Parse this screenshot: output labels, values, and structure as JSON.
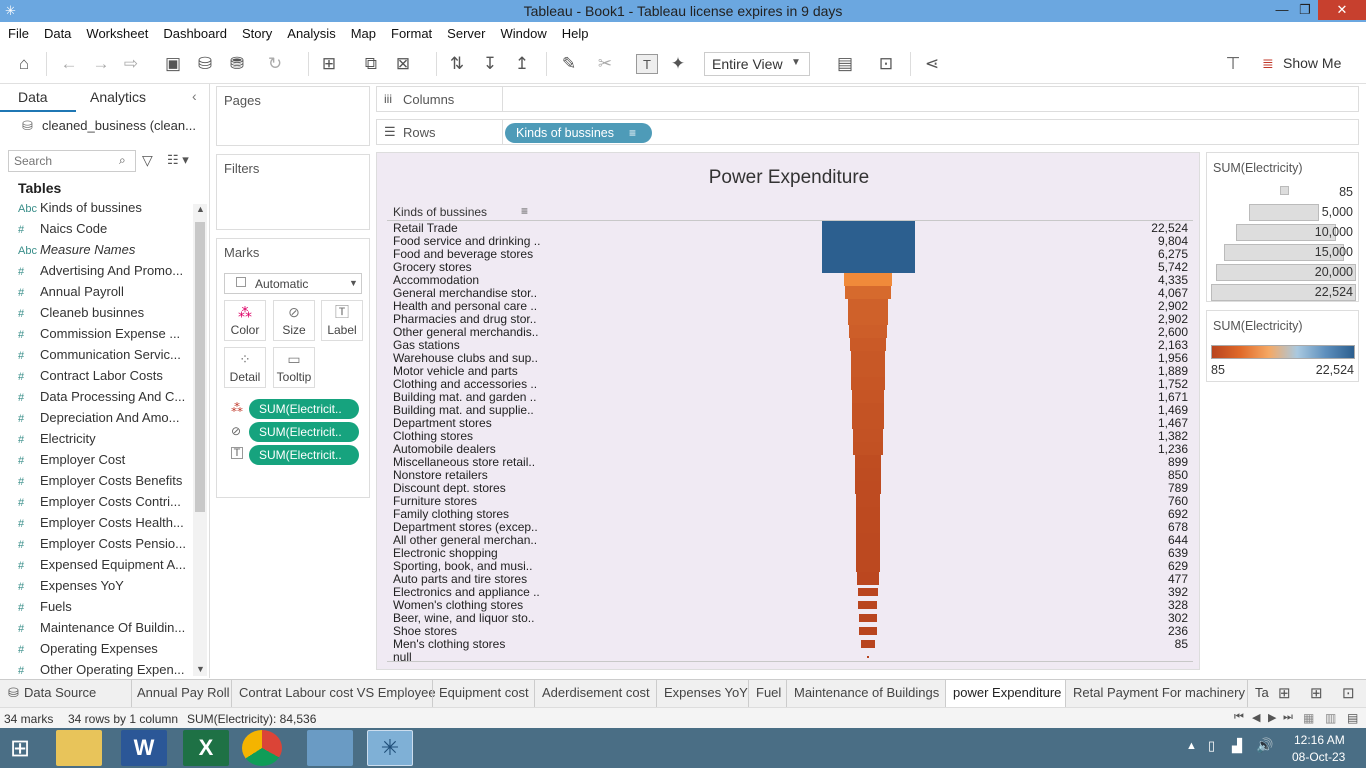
{
  "window": {
    "title": "Tableau - Book1 - Tableau license expires in 9 days",
    "minimize": "—",
    "restore": "❐",
    "close": "✕"
  },
  "menu": [
    "File",
    "Data",
    "Worksheet",
    "Dashboard",
    "Story",
    "Analysis",
    "Map",
    "Format",
    "Server",
    "Window",
    "Help"
  ],
  "toolbar": {
    "fit": "Entire View",
    "show_me": "Show Me"
  },
  "left": {
    "tab_data": "Data",
    "tab_analytics": "Analytics",
    "datasource": "cleaned_business (clean...",
    "search_placeholder": "Search",
    "tables_heading": "Tables",
    "fields": [
      {
        "type": "Abc",
        "name": "Kinds of bussines"
      },
      {
        "type": "#",
        "name": "Naics Code"
      },
      {
        "type": "Abc",
        "name": "Measure Names"
      },
      {
        "type": "#",
        "name": "Advertising And Promo..."
      },
      {
        "type": "#",
        "name": "Annual Payroll"
      },
      {
        "type": "#",
        "name": "Cleaneb businnes"
      },
      {
        "type": "#",
        "name": "Commission Expense ..."
      },
      {
        "type": "#",
        "name": "Communication Servic..."
      },
      {
        "type": "#",
        "name": "Contract Labor Costs"
      },
      {
        "type": "#",
        "name": "Data Processing And C..."
      },
      {
        "type": "#",
        "name": "Depreciation And Amo..."
      },
      {
        "type": "#",
        "name": "Electricity"
      },
      {
        "type": "#",
        "name": "Employer Cost"
      },
      {
        "type": "#",
        "name": "Employer Costs Benefits"
      },
      {
        "type": "#",
        "name": "Employer Costs Contri..."
      },
      {
        "type": "#",
        "name": "Employer Costs Health..."
      },
      {
        "type": "#",
        "name": "Employer Costs Pensio..."
      },
      {
        "type": "#",
        "name": "Expensed Equipment A..."
      },
      {
        "type": "#",
        "name": "Expenses YoY"
      },
      {
        "type": "#",
        "name": "Fuels"
      },
      {
        "type": "#",
        "name": "Maintenance Of Buildin..."
      },
      {
        "type": "#",
        "name": "Operating Expenses"
      },
      {
        "type": "#",
        "name": "Other Operating Expen..."
      }
    ]
  },
  "cards": {
    "pages": "Pages",
    "filters": "Filters",
    "marks": "Marks",
    "mark_type": "Automatic",
    "buttons": {
      "color": "Color",
      "size": "Size",
      "label": "Label",
      "detail": "Detail",
      "tooltip": "Tooltip"
    },
    "pills": [
      "SUM(Electricit..",
      "SUM(Electricit..",
      "SUM(Electricit.."
    ]
  },
  "shelves": {
    "columns": "Columns",
    "rows": "Rows",
    "rows_pill": "Kinds of bussines"
  },
  "chart_data": {
    "type": "bar",
    "title": "Power Expenditure",
    "row_header": "Kinds of bussines",
    "categories": [
      "Retail Trade",
      "Food service and drinking ..",
      "Food and beverage stores",
      "Grocery stores",
      "Accommodation",
      "General merchandise stor..",
      "Health and personal care ..",
      "Pharmacies and drug stor..",
      "Other general merchandis..",
      "Gas stations",
      "Warehouse clubs and sup..",
      "Motor vehicle and parts",
      "Clothing and accessories ..",
      "Building mat. and garden ..",
      "Building mat. and supplie..",
      "Department stores",
      "Clothing stores",
      "Automobile dealers",
      "Miscellaneous store retail..",
      "Nonstore retailers",
      "Discount dept. stores",
      "Furniture stores",
      "Family clothing stores",
      "Department stores (excep..",
      "All other general merchan..",
      "Electronic shopping",
      "Sporting, book, and  musi..",
      "Auto parts and tire stores",
      "Electronics and appliance ..",
      "Women's clothing stores",
      "Beer, wine, and liquor sto..",
      "Shoe stores",
      "Men's clothing stores",
      "null"
    ],
    "values": [
      22524,
      9804,
      6275,
      5742,
      4335,
      4067,
      2902,
      2902,
      2600,
      2163,
      1956,
      1889,
      1752,
      1671,
      1469,
      1467,
      1382,
      1236,
      899,
      850,
      789,
      760,
      692,
      678,
      644,
      639,
      629,
      477,
      392,
      328,
      302,
      236,
      85,
      null
    ],
    "labels": [
      "22,524",
      "9,804",
      "6,275",
      "5,742",
      "4,335",
      "4,067",
      "2,902",
      "2,902",
      "2,600",
      "2,163",
      "1,956",
      "1,889",
      "1,752",
      "1,671",
      "1,469",
      "1,467",
      "1,382",
      "1,236",
      "899",
      "850",
      "789",
      "760",
      "692",
      "678",
      "644",
      "639",
      "629",
      "477",
      "392",
      "328",
      "302",
      "236",
      "85",
      ""
    ],
    "color_measure": "SUM(Electricity)",
    "size_measure": "SUM(Electricity)",
    "color_range": [
      85,
      22524
    ],
    "colors": {
      "high": "#2c5f8f",
      "mid": "#f08a3a",
      "low": "#b8441e"
    }
  },
  "legends": {
    "size_title": "SUM(Electricity)",
    "size_labels": [
      "85",
      "5,000",
      "10,000",
      "15,000",
      "20,000",
      "22,524"
    ],
    "color_title": "SUM(Electricity)",
    "color_min": "85",
    "color_max": "22,524"
  },
  "tabs": [
    "Data Source",
    "Annual Pay Roll",
    "Contrat Labour cost VS Employee",
    "Equipment cost",
    "Aderdisement cost",
    "Expenses YoY",
    "Fuel",
    "Maintenance of Buildings",
    "power Expenditure",
    "Retal Payment For machinery",
    "Ta"
  ],
  "status": {
    "marks": "34 marks",
    "rows": "34 rows by 1 column",
    "sum": "SUM(Electricity): 84,536"
  },
  "clock": {
    "time": "12:16 AM",
    "date": "08-Oct-23"
  }
}
